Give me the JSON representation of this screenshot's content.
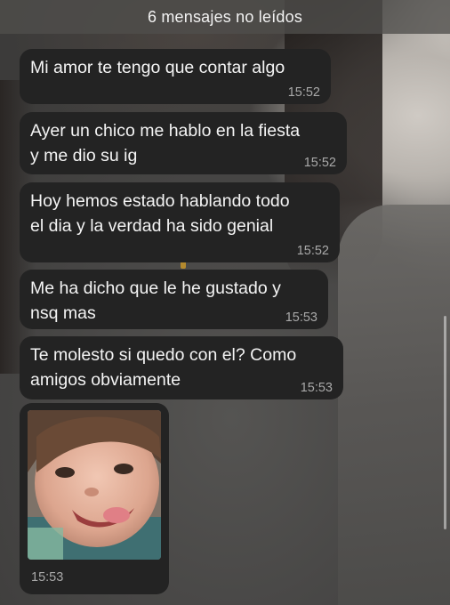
{
  "banner": {
    "text": "6 mensajes no leídos"
  },
  "messages": [
    {
      "text": "Mi amor te tengo que contar algo",
      "time": "15:52"
    },
    {
      "text": "Ayer un chico me hablo en la fiesta\ny me dio su ig",
      "time": "15:52"
    },
    {
      "text": "Hoy hemos estado hablando todo\nel dia y la verdad ha sido genial",
      "time": "15:52"
    },
    {
      "text": "Me ha dicho que le he gustado y\nnsq mas",
      "time": "15:53"
    },
    {
      "text": "Te molesto si quedo con el? Como\namigos obviamente",
      "time": "15:53"
    }
  ],
  "image_message": {
    "time": "15:53"
  },
  "colors": {
    "bubble": "#232323",
    "text": "#f4f4f4",
    "timestamp": "#a9a9a9",
    "banner": "#504e4c"
  }
}
